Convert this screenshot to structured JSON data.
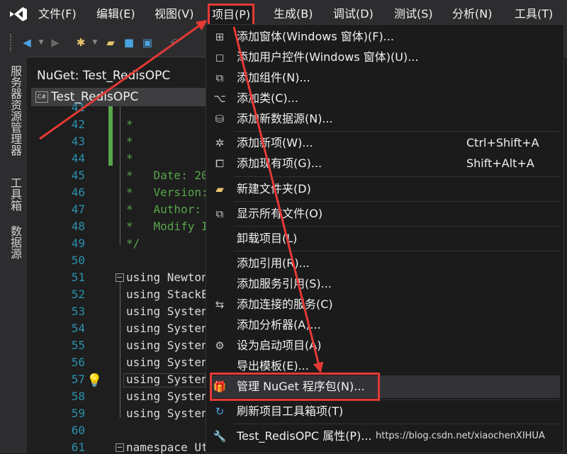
{
  "menubar": {
    "items": [
      "文件(F)",
      "编辑(E)",
      "视图(V)",
      "项目(P)",
      "生成(B)",
      "调试(D)",
      "测试(S)",
      "分析(N)",
      "工具(T)"
    ]
  },
  "leftrail": {
    "tabs": [
      "服务器资源管理器",
      "工具箱",
      "数据源"
    ]
  },
  "doc": {
    "nuget_tab": "NuGet: Test_RedisOPC",
    "editor_tab": "Test_RedisOPC",
    "file_icon": "C#"
  },
  "code": {
    "lines": [
      {
        "n": "41",
        "t": ""
      },
      {
        "n": "42",
        "t": "*"
      },
      {
        "n": "43",
        "t": "*"
      },
      {
        "n": "44",
        "t": "*"
      },
      {
        "n": "45",
        "t": "*   Date: 20"
      },
      {
        "n": "46",
        "t": "*   Version:"
      },
      {
        "n": "47",
        "t": "*   Author: "
      },
      {
        "n": "48",
        "t": "*   Modify I"
      },
      {
        "n": "49",
        "t": "*/"
      },
      {
        "n": "50",
        "t": ""
      },
      {
        "n": "51",
        "t": "using Newton"
      },
      {
        "n": "52",
        "t": "using StackE"
      },
      {
        "n": "53",
        "t": "using Systen"
      },
      {
        "n": "54",
        "t": "using Systen"
      },
      {
        "n": "55",
        "t": "using Systen"
      },
      {
        "n": "56",
        "t": "using Systen"
      },
      {
        "n": "57",
        "t": "using Systen"
      },
      {
        "n": "58",
        "t": "using Systen"
      },
      {
        "n": "59",
        "t": "using Systen"
      },
      {
        "n": "60",
        "t": ""
      },
      {
        "n": "61",
        "t": "namespace Utils"
      }
    ]
  },
  "project_menu": {
    "items": [
      {
        "label": "添加窗体(Windows 窗体)(F)...",
        "icon": "add-form-icon"
      },
      {
        "label": "添加用户控件(Windows 窗体)(U)...",
        "icon": "add-user-control-icon"
      },
      {
        "label": "添加组件(N)...",
        "icon": "add-component-icon"
      },
      {
        "label": "添加类(C)...",
        "icon": "add-class-icon"
      },
      {
        "label": "添加新数据源(N)...",
        "icon": "add-data-source-icon"
      },
      {
        "label": "添加新项(W)...",
        "icon": "add-new-item-icon",
        "shortcut": "Ctrl+Shift+A"
      },
      {
        "label": "添加现有项(G)...",
        "icon": "add-existing-item-icon",
        "shortcut": "Shift+Alt+A"
      },
      {
        "label": "新建文件夹(D)",
        "icon": "new-folder-icon"
      },
      {
        "label": "显示所有文件(O)",
        "icon": "show-all-files-icon"
      },
      {
        "label": "卸载项目(L)",
        "icon": ""
      },
      {
        "label": "添加引用(R)...",
        "icon": ""
      },
      {
        "label": "添加服务引用(S)...",
        "icon": ""
      },
      {
        "label": "添加连接的服务(C)",
        "icon": "connected-service-icon"
      },
      {
        "label": "添加分析器(A)...",
        "icon": ""
      },
      {
        "label": "设为启动项目(A)",
        "icon": "gear-icon"
      },
      {
        "label": "导出模板(E)...",
        "icon": ""
      },
      {
        "label": "管理 NuGet 程序包(N)...",
        "icon": "nuget-package-icon"
      },
      {
        "label": "刷新项目工具箱项(T)",
        "icon": "refresh-icon"
      },
      {
        "label": "Test_RedisOPC 属性(P)...",
        "icon": "wrench-icon"
      }
    ]
  },
  "watermark": "https://blog.csdn.net/xiaochenXIHUA",
  "colors": {
    "annotation": "#e53935",
    "menu_bg": "#1b1b1c",
    "chrome": "#2d2d30"
  }
}
